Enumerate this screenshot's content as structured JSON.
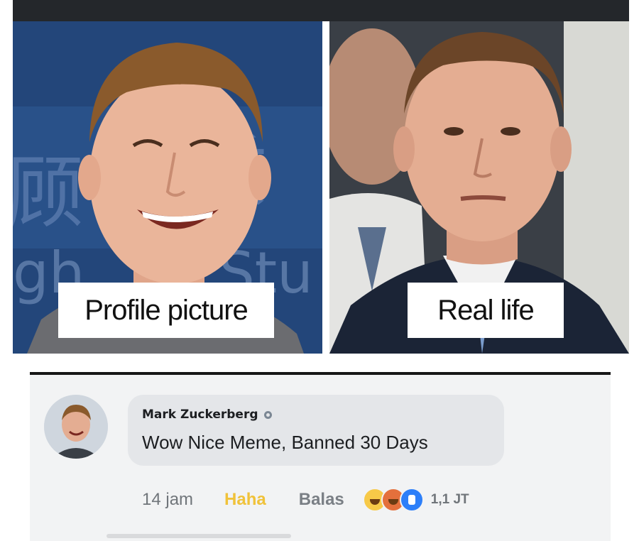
{
  "meme": {
    "left_caption": "Profile picture",
    "right_caption": "Real life"
  },
  "comment": {
    "author": "Mark Zuckerberg",
    "text": "Wow Nice Meme, Banned 30 Days",
    "time": "14 jam",
    "reaction_label": "Haha",
    "reply_label": "Balas",
    "reaction_count": "1,1 JT",
    "reaction_icons": [
      "haha-icon",
      "angry-icon",
      "like-icon"
    ]
  },
  "colors": {
    "top_bar": "#24272b",
    "left_background": "#23467a",
    "haha_text": "#f0c23a",
    "comment_bg": "#f2f3f4",
    "bubble_bg": "#e4e6e9"
  }
}
